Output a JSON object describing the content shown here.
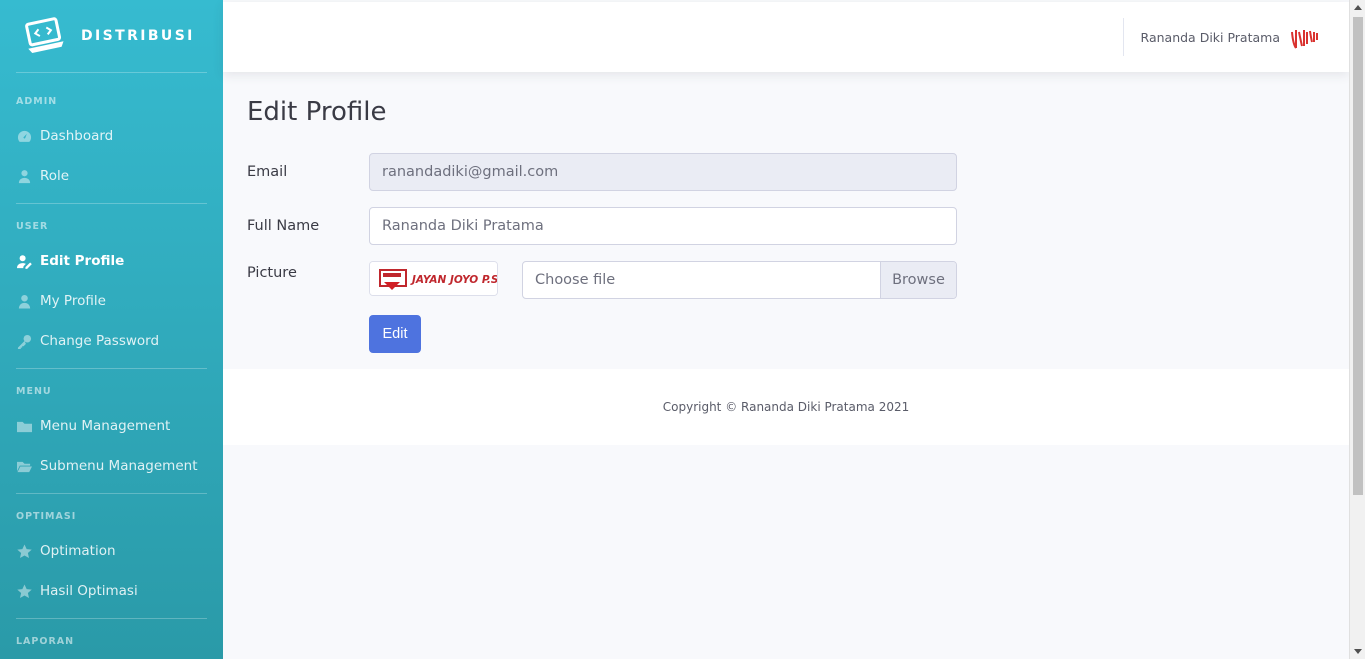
{
  "brand": {
    "name": "DISTRIBUSI",
    "icon": "laptop-code-icon"
  },
  "sidebar": {
    "sections": [
      {
        "heading": "ADMIN",
        "items": [
          {
            "label": "Dashboard",
            "icon": "tachometer-icon"
          },
          {
            "label": "Role",
            "icon": "user-tie-icon"
          }
        ]
      },
      {
        "heading": "USER",
        "items": [
          {
            "label": "Edit Profile",
            "icon": "user-edit-icon",
            "active": true
          },
          {
            "label": "My Profile",
            "icon": "user-icon"
          },
          {
            "label": "Change Password",
            "icon": "key-icon"
          }
        ]
      },
      {
        "heading": "MENU",
        "items": [
          {
            "label": "Menu Management",
            "icon": "folder-icon"
          },
          {
            "label": "Submenu Management",
            "icon": "folder-open-icon"
          }
        ]
      },
      {
        "heading": "OPTIMASI",
        "items": [
          {
            "label": "Optimation",
            "icon": "star-icon"
          },
          {
            "label": "Hasil Optimasi",
            "icon": "star-icon"
          }
        ]
      },
      {
        "heading": "LAPORAN",
        "items": []
      }
    ]
  },
  "topbar": {
    "user_name": "Rananda Diki Pratama"
  },
  "page": {
    "title": "Edit Profile",
    "form": {
      "email_label": "Email",
      "email_value": "ranandadiki@gmail.com",
      "fullname_label": "Full Name",
      "fullname_value": "Rananda Diki Pratama",
      "picture_label": "Picture",
      "picture_thumb_text": "JAYAN JOYO P.S",
      "file_placeholder": "Choose file",
      "browse_label": "Browse",
      "submit_label": "Edit"
    }
  },
  "footer": {
    "copyright": "Copyright © Rananda Diki Pratama 2021"
  },
  "colors": {
    "sidebar_top": "#36bbd0",
    "sidebar_bottom": "#2a9aa8",
    "primary": "#4e73df",
    "background": "#f8f9fc"
  }
}
